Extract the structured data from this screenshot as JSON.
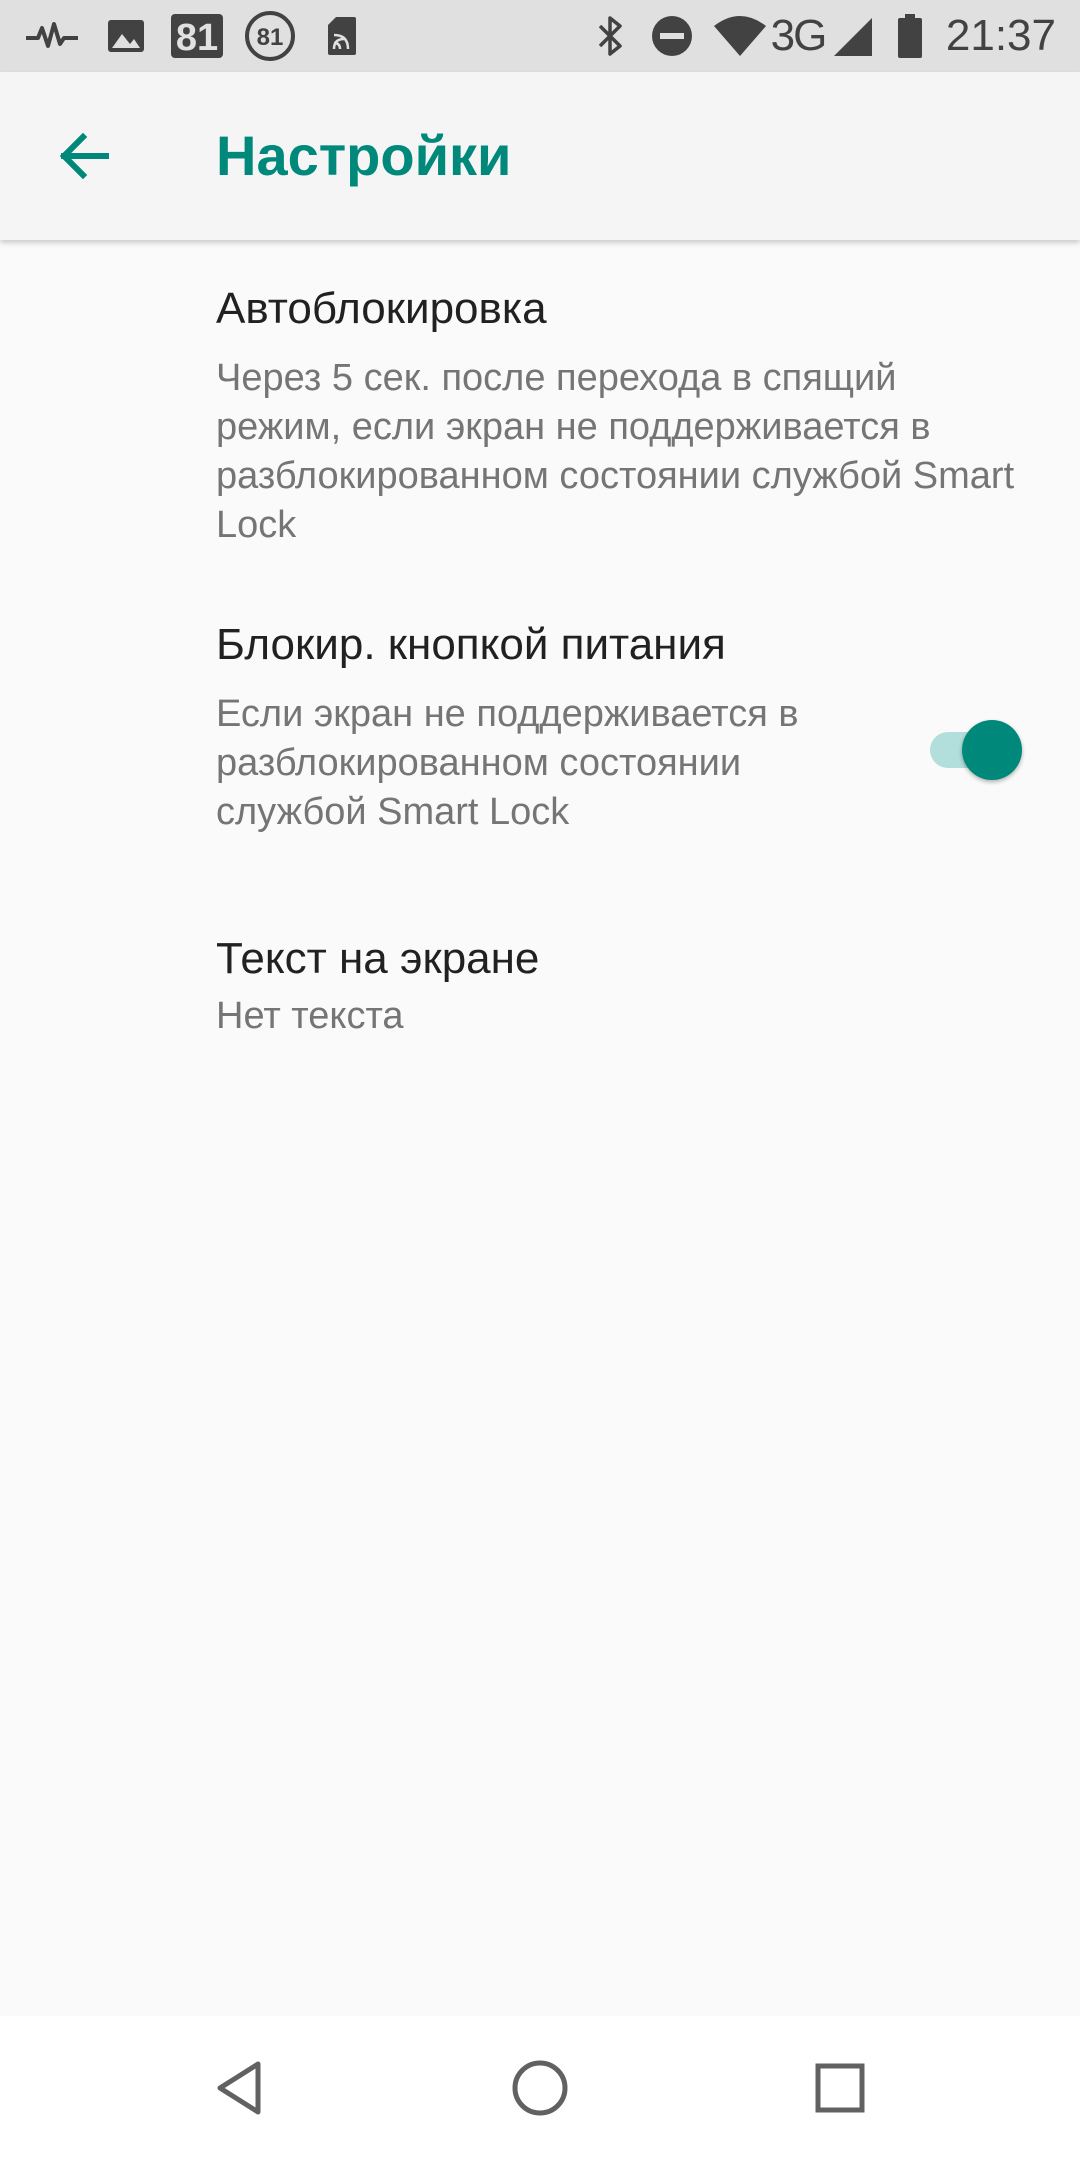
{
  "status_bar": {
    "time": "21:37",
    "network": "3G",
    "notification_badge_1": "81",
    "notification_badge_2": "81",
    "icons": [
      "pulse-icon",
      "image-icon",
      "badge-81-icon",
      "circle-81-icon",
      "sim-card-icon",
      "bluetooth-icon",
      "do-not-disturb-icon",
      "wifi-icon",
      "cell-signal-icon",
      "battery-icon"
    ]
  },
  "app_bar": {
    "title": "Настройки",
    "back_icon": "arrow-back-icon",
    "accent_color": "#00897b"
  },
  "settings": [
    {
      "title": "Автоблокировка",
      "summary": "Через 5 сек. после перехода в спящий режим, если экран не поддерживается в разблокированном состоянии службой Smart Lock"
    },
    {
      "title": "Блокир. кнопкой питания",
      "summary": "Если экран не поддерживается в разблокированном состоянии службой Smart Lock",
      "toggle_on": true
    },
    {
      "title": "Текст на экране",
      "summary": "Нет текста"
    }
  ],
  "nav_bar": {
    "icons": [
      "back-triangle-icon",
      "home-circle-icon",
      "recents-square-icon"
    ]
  }
}
